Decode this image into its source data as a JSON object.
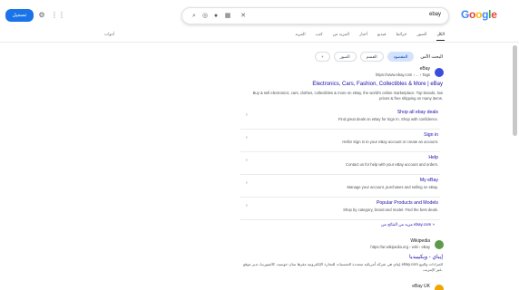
{
  "header": {
    "logo_letters": [
      {
        "ch": "G",
        "color": "#4285f4"
      },
      {
        "ch": "o",
        "color": "#ea4335"
      },
      {
        "ch": "o",
        "color": "#fbbc05"
      },
      {
        "ch": "g",
        "color": "#4285f4"
      },
      {
        "ch": "l",
        "color": "#34a853"
      },
      {
        "ch": "e",
        "color": "#ea4335"
      }
    ],
    "search_query": "ebay",
    "search_icons": [
      "close-icon",
      "keyboard-icon",
      "mic-icon",
      "lens-icon",
      "search-icon"
    ],
    "signin_label": "تسجيل",
    "apps_icon": "apps-icon",
    "settings_icon": "settings-icon"
  },
  "tabs": {
    "items": [
      "الكل",
      "الصور",
      "خرائط",
      "فيديو",
      "أخبار",
      "المزيد من",
      "كتب",
      "المزيد"
    ],
    "active_index": 0,
    "tools_label": "أدوات"
  },
  "chips": {
    "label": "البحث الآمن",
    "items": [
      "المقصود",
      "القسم",
      "الصور",
      "+"
    ],
    "active_index": 0
  },
  "result1": {
    "site_name": "eBay",
    "url": "https://www.ebay.com › ... › Tags",
    "title": "Electronics, Cars, Fashion, Collectibles & More | eBay",
    "snippet": "Buy & sell electronics, cars, clothes, collectibles & more on eBay, the world's online marketplace. Top brands, low prices & free shipping on many items.",
    "subresults": [
      {
        "title": "Shop all ebay deals",
        "snippet": "Find great deals on eBay for Sign In. Shop with confidence."
      },
      {
        "title": "Sign in",
        "snippet": "Hello! Sign in to your eBay account or create an account."
      },
      {
        "title": "Help",
        "snippet": "Contact us for help with your eBay account and orders."
      },
      {
        "title": "My eBay",
        "snippet": "Manage your account, purchases and selling on eBay."
      },
      {
        "title": "Popular Products and Models",
        "snippet": "Shop by category, brand and model. Find the best deals."
      }
    ],
    "more_label": "مزيد من النتائج من ebay.com »"
  },
  "result2": {
    "site_name": "Wikipedia",
    "url": "https://ar.wikipedia.org › wiki › eBay",
    "title": "إيباي - ويكيبيديا",
    "snippet": "إيباي هي شركة أمريكية متعددة الجنسيات للتجارة الإلكترونية مقرها سان خوسيه، كاليفورنيا، تدير موقع eBay.com للمزادات والبيع عبر الإنترنت."
  },
  "result3": {
    "site_name": "eBay UK"
  },
  "colors": {
    "link": "#1a0dab",
    "accent": "#1a73e8",
    "chip_active": "#d3e3fd"
  }
}
